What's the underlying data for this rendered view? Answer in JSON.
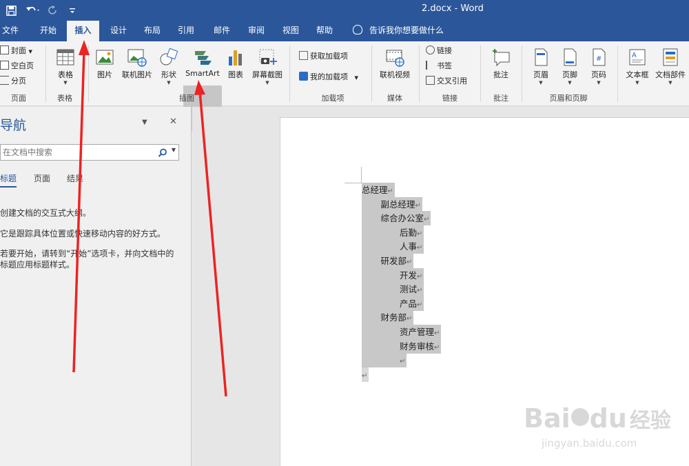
{
  "window": {
    "title": "2.docx  -  Word"
  },
  "quick_access": {
    "save_icon": "save-icon",
    "undo_icon": "undo-icon",
    "redo_icon": "redo-icon",
    "customize_icon": "customize-icon"
  },
  "tabs": [
    {
      "label": "文件"
    },
    {
      "label": "开始"
    },
    {
      "label": "插入"
    },
    {
      "label": "设计"
    },
    {
      "label": "布局"
    },
    {
      "label": "引用"
    },
    {
      "label": "邮件"
    },
    {
      "label": "审阅"
    },
    {
      "label": "视图"
    },
    {
      "label": "帮助"
    }
  ],
  "tellme": {
    "label": "告诉我你想要做什么"
  },
  "ribbon": {
    "pages": {
      "cover": "封面",
      "blank": "空白页",
      "break": "分页",
      "group": "页面"
    },
    "tables": {
      "table": "表格",
      "group": "表格"
    },
    "illustrations": {
      "pictures": "图片",
      "online_pictures": "联机图片",
      "shapes": "形状",
      "smartart": "SmartArt",
      "chart": "图表",
      "screenshot": "屏幕截图",
      "group": "插图"
    },
    "addins": {
      "get": "获取加载项",
      "my": "我的加载项",
      "group": "加载项"
    },
    "media": {
      "online_video": "联机视频",
      "group": "媒体"
    },
    "links": {
      "link": "链接",
      "bookmark": "书签",
      "crossref": "交叉引用",
      "group": "链接"
    },
    "comments": {
      "comment": "批注",
      "group": "批注"
    },
    "header_footer": {
      "header": "页眉",
      "footer": "页脚",
      "page_number": "页码",
      "group": "页眉和页脚"
    },
    "text": {
      "textbox": "文本框",
      "quickparts": "文档部件"
    }
  },
  "nav": {
    "title": "导航",
    "search_placeholder": "在文档中搜索",
    "tabs": [
      "标题",
      "页面",
      "结果"
    ],
    "line1": "创建文档的交互式大纲。",
    "line2": "它是跟踪具体位置或快速移动内容的好方式。",
    "line3": "若要开始，请转到“开始”选项卡，并向文档中的标题应用标题样式。"
  },
  "document": {
    "lines": [
      {
        "text": "总经理",
        "level": 0
      },
      {
        "text": "副总经理",
        "level": 1
      },
      {
        "text": "综合办公室",
        "level": 1
      },
      {
        "text": "后勤",
        "level": 2
      },
      {
        "text": "人事",
        "level": 2
      },
      {
        "text": "研发部",
        "level": 1
      },
      {
        "text": "开发",
        "level": 2
      },
      {
        "text": "测试",
        "level": 2
      },
      {
        "text": "产品",
        "level": 2
      },
      {
        "text": "财务部",
        "level": 1
      },
      {
        "text": "资产管理",
        "level": 2
      },
      {
        "text": "财务审核",
        "level": 2
      },
      {
        "text": "",
        "level": 2
      },
      {
        "text": "",
        "level": 0
      }
    ],
    "paragraph_mark": "↵"
  },
  "watermark": {
    "brand": "Bai",
    "brand2": "du",
    "cn": "经验",
    "url": "jingyan.baidu.com"
  },
  "colors": {
    "accent": "#2b579a",
    "arrow": "#ee2222"
  }
}
